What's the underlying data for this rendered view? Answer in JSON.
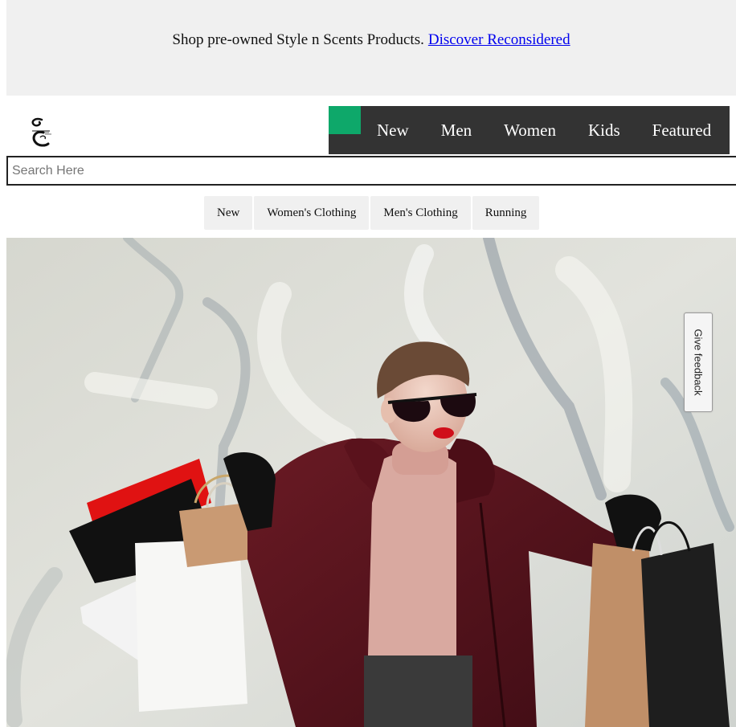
{
  "promo": {
    "text": "Shop pre-owned Style n Scents Products.",
    "link_label": "Discover Reconsidered"
  },
  "logo": {
    "icon": "style-n-scents-logo",
    "text": "Style n Scents"
  },
  "mainnav": {
    "accent_color": "#0ea86a",
    "background_color": "#333333",
    "items": [
      "New",
      "Men",
      "Women",
      "Kids",
      "Featured"
    ]
  },
  "search": {
    "placeholder": "Search Here",
    "value": ""
  },
  "categories": [
    "New",
    "Women's Clothing",
    "Men's Clothing",
    "Running"
  ],
  "hero": {
    "image_description_icon": "hero-shopping-woman-image"
  },
  "feedback": {
    "label": "Give feedback"
  }
}
